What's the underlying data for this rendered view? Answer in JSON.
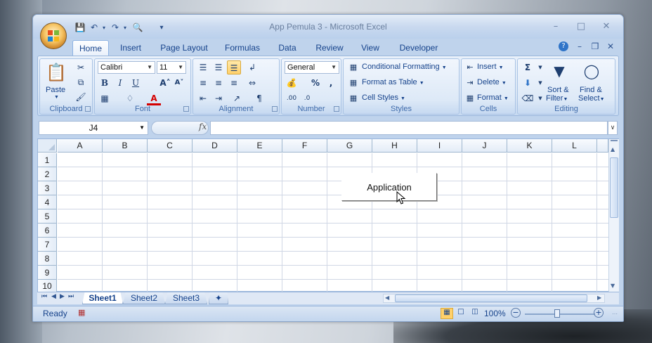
{
  "window": {
    "title": "App Pemula 3 - Microsoft Excel"
  },
  "ribbon_tabs": [
    "Home",
    "Insert",
    "Page Layout",
    "Formulas",
    "Data",
    "Review",
    "View",
    "Developer"
  ],
  "clipboard": {
    "paste_label": "Paste",
    "group_label": "Clipboard"
  },
  "font": {
    "family": "Calibri",
    "size": "11",
    "group_label": "Font"
  },
  "alignment": {
    "group_label": "Alignment"
  },
  "number": {
    "format": "General",
    "group_label": "Number"
  },
  "styles": {
    "conditional_formatting": "Conditional Formatting",
    "format_as_table": "Format as Table",
    "cell_styles": "Cell Styles",
    "group_label": "Styles"
  },
  "cells": {
    "insert": "Insert",
    "delete": "Delete",
    "format": "Format",
    "group_label": "Cells"
  },
  "editing": {
    "sort_filter_line1": "Sort &",
    "sort_filter_line2": "Filter",
    "find_select_line1": "Find &",
    "find_select_line2": "Select",
    "group_label": "Editing"
  },
  "formula_bar": {
    "name_box": "J4",
    "fx": "fx",
    "value": ""
  },
  "columns": [
    "A",
    "B",
    "C",
    "D",
    "E",
    "F",
    "G",
    "H",
    "I",
    "J",
    "K",
    "L"
  ],
  "rows": [
    "1",
    "2",
    "3",
    "4",
    "5",
    "6",
    "7",
    "8",
    "9",
    "10"
  ],
  "embedded_button": {
    "label": "Application"
  },
  "sheet_tabs": [
    "Sheet1",
    "Sheet2",
    "Sheet3"
  ],
  "status": {
    "ready": "Ready",
    "zoom": "100%"
  }
}
